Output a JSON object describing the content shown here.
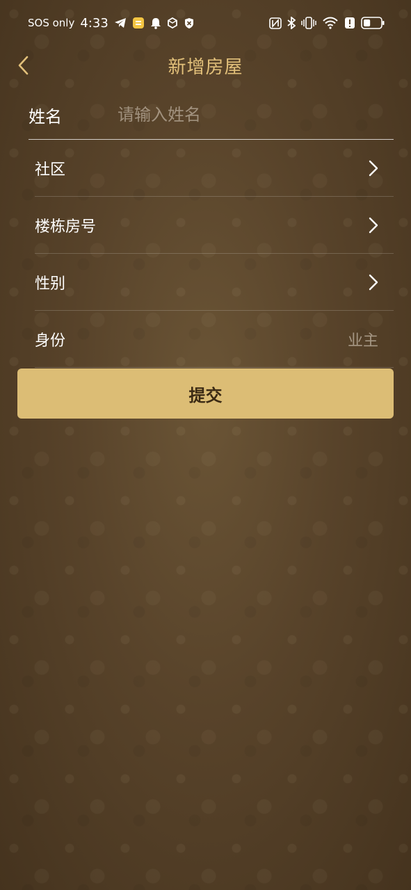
{
  "status_bar": {
    "carrier": "SOS only",
    "time": "4:33",
    "left_icons": [
      "telegram-icon",
      "app-notification-icon",
      "bell-icon",
      "box-icon",
      "shield-x-icon"
    ],
    "right_icons": [
      "nfc-icon",
      "bluetooth-icon",
      "vibrate-icon",
      "wifi-icon",
      "alert-icon",
      "battery-icon"
    ],
    "battery_level": 0.4
  },
  "header": {
    "title": "新增房屋"
  },
  "form": {
    "name": {
      "label": "姓名",
      "value": "",
      "placeholder": "请输入姓名"
    },
    "rows": [
      {
        "label": "社区",
        "value": "",
        "icon": "chevron-right-icon"
      },
      {
        "label": "楼栋房号",
        "value": "",
        "icon": "chevron-right-icon"
      },
      {
        "label": "性别",
        "value": "",
        "icon": "chevron-right-icon"
      },
      {
        "label": "身份",
        "value": "业主"
      }
    ]
  },
  "submit_label": "提交",
  "colors": {
    "accent": "#e2c07a",
    "button": "#dcbd75",
    "button_text": "#3b2a14",
    "background": "#58432a"
  }
}
